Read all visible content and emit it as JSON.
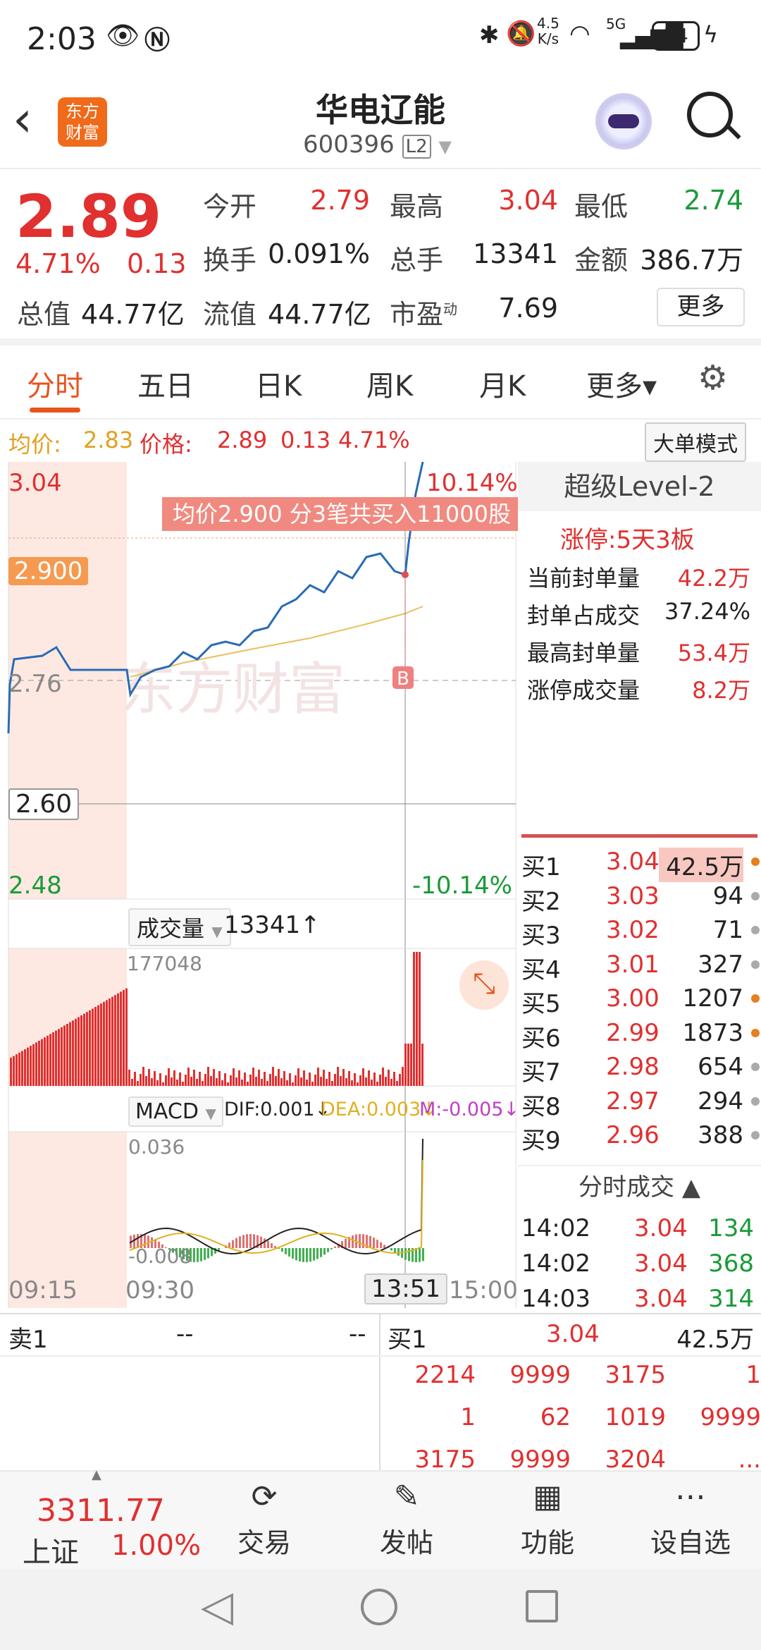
{
  "status": {
    "time": "2:03",
    "net_speed": "4.5",
    "net_unit": "K/s",
    "signal": "5G",
    "battery": "34"
  },
  "header": {
    "name": "华电辽能",
    "code": "600396",
    "level": "L2",
    "brand": "东方\n财富"
  },
  "quote": {
    "price": "2.89",
    "pct": "4.71%",
    "chg": "0.13",
    "open_label": "今开",
    "open": "2.79",
    "high_label": "最高",
    "high": "3.04",
    "low_label": "最低",
    "low": "2.74",
    "turnover_label": "换手",
    "turnover": "0.091%",
    "vol_label": "总手",
    "vol": "13341",
    "amount_label": "金额",
    "amount": "386.7万",
    "mcap_label": "总值",
    "mcap": "44.77亿",
    "float_label": "流值",
    "float": "44.77亿",
    "pe_label": "市盈",
    "pe_sup": "动",
    "pe": "7.69",
    "more": "更多"
  },
  "tabs": [
    "分时",
    "五日",
    "日K",
    "周K",
    "月K",
    "更多▾"
  ],
  "info": {
    "avg_label": "均价:",
    "avg": "2.83",
    "price_label": "价格:",
    "price": "2.89",
    "chg": "0.13",
    "pct": "4.71%",
    "mode": "大单模式"
  },
  "chart": {
    "y_top": "3.04",
    "y_mid": "2.76",
    "y_bot": "2.48",
    "y_cursor": "2.60",
    "pct_top": "10.14%",
    "pct_bot": "-10.14%",
    "marker": "2.900",
    "tip": "均价2.900  分3笔共买入11000股",
    "b_mark": "B",
    "watermark": "东方财富",
    "vol_label": "成交量",
    "vol_val": "13341↑",
    "vol_max": "177048",
    "macd": "MACD",
    "dif": "DIF:0.001↓",
    "dea": "DEA:0.003↓",
    "m": "M:-0.005↓",
    "macd_top": "0.036",
    "macd_bot": "-0.008",
    "t1": "09:15",
    "t2": "09:30",
    "t3": "13:51",
    "t4": "15:00"
  },
  "level2": {
    "title": "超级Level-2",
    "limit_up": "涨停:5天3板",
    "rows": [
      {
        "k": "当前封单量",
        "v": "42.2万"
      },
      {
        "k": "封单占成交",
        "v": "37.24%"
      },
      {
        "k": "最高封单量",
        "v": "53.4万"
      },
      {
        "k": "涨停成交量",
        "v": "8.2万"
      }
    ]
  },
  "orderbook": [
    {
      "l": "买1",
      "p": "3.04",
      "q": "42.5万",
      "d": "#e67e22"
    },
    {
      "l": "买2",
      "p": "3.03",
      "q": "94",
      "d": "#aaa"
    },
    {
      "l": "买3",
      "p": "3.02",
      "q": "71",
      "d": "#aaa"
    },
    {
      "l": "买4",
      "p": "3.01",
      "q": "327",
      "d": "#aaa"
    },
    {
      "l": "买5",
      "p": "3.00",
      "q": "1207",
      "d": "#e67e22"
    },
    {
      "l": "买6",
      "p": "2.99",
      "q": "1873",
      "d": "#e67e22"
    },
    {
      "l": "买7",
      "p": "2.98",
      "q": "654",
      "d": "#aaa"
    },
    {
      "l": "买8",
      "p": "2.97",
      "q": "294",
      "d": "#aaa"
    },
    {
      "l": "买9",
      "p": "2.96",
      "q": "388",
      "d": "#aaa"
    }
  ],
  "ticks_title": "分时成交 ▲",
  "ticks": [
    {
      "t": "14:02",
      "p": "3.04",
      "v": "134"
    },
    {
      "t": "14:02",
      "p": "3.04",
      "v": "368"
    },
    {
      "t": "14:03",
      "p": "3.04",
      "v": "314"
    }
  ],
  "queue": {
    "sell_label": "卖1",
    "sell_p": "--",
    "sell_q": "--",
    "buy_label": "买1",
    "buy_p": "3.04",
    "buy_q": "42.5万",
    "rows": [
      [
        "2214",
        "9999",
        "3175",
        "1"
      ],
      [
        "1",
        "62",
        "1019",
        "9999"
      ],
      [
        "3175",
        "9999",
        "3204",
        "..."
      ]
    ]
  },
  "nav": {
    "index_val": "3311.77",
    "index_name": "上证",
    "index_pct": "1.00%",
    "items": [
      "交易",
      "发帖",
      "功能",
      "设自选"
    ]
  }
}
